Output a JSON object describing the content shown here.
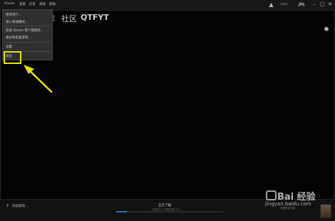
{
  "menubar": {
    "items": [
      "Steam",
      "查看",
      "好友",
      "游戏",
      "帮助"
    ],
    "account_name": "qtfyt"
  },
  "nav": {
    "partial_label": "库",
    "community_label": "社区",
    "profile_label": "QTFYT"
  },
  "dropdown": {
    "items": [
      "更改用户…",
      "进入离线模式…",
      "检查 Steam 客户端更新…",
      "备份和恢复游戏…",
      "设置",
      "退出"
    ]
  },
  "bottombar": {
    "add_game": "添加游戏…",
    "download_title": "正在下载",
    "download_sub": "已完成 0 个项目中的 0 个",
    "download_progress": 0.1,
    "friends_list": "查看好友列表"
  },
  "watermark": {
    "text": "Bai 经验",
    "url": "jingyan.baidu.com"
  },
  "colors": {
    "highlight": "#e6e600",
    "arrow": "#e6e600",
    "progress": "#2d6fb0"
  }
}
